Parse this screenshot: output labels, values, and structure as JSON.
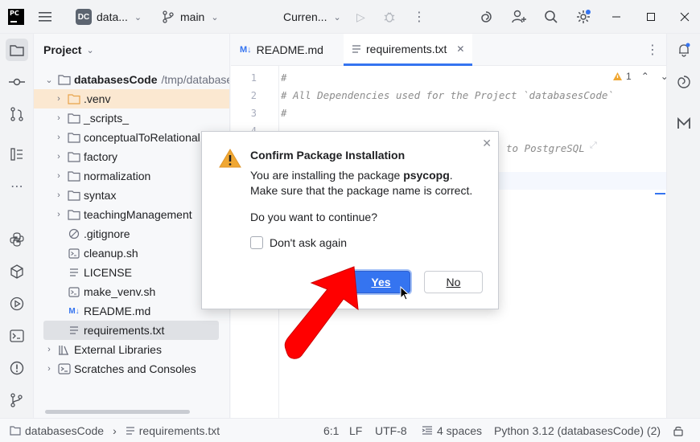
{
  "titlebar": {
    "logo": "PC",
    "project_badge": "DC",
    "project_name": "data...",
    "branch": "main",
    "run_config": "Curren..."
  },
  "project_panel": {
    "title": "Project",
    "root": {
      "name": "databasesCode",
      "path": "/tmp/database"
    },
    "items": [
      {
        "label": ".venv",
        "type": "folder",
        "expandable": true
      },
      {
        "label": "_scripts_",
        "type": "folder",
        "expandable": true
      },
      {
        "label": "conceptualToRelational",
        "type": "folder",
        "expandable": true
      },
      {
        "label": "factory",
        "type": "folder",
        "expandable": true
      },
      {
        "label": "normalization",
        "type": "folder",
        "expandable": true
      },
      {
        "label": "syntax",
        "type": "folder",
        "expandable": true
      },
      {
        "label": "teachingManagement",
        "type": "folder",
        "expandable": true
      },
      {
        "label": ".gitignore",
        "type": "ignore-file"
      },
      {
        "label": "cleanup.sh",
        "type": "shell-file"
      },
      {
        "label": "LICENSE",
        "type": "text-file"
      },
      {
        "label": "make_venv.sh",
        "type": "shell-file"
      },
      {
        "label": "README.md",
        "type": "markdown-file"
      },
      {
        "label": "requirements.txt",
        "type": "text-file"
      }
    ],
    "external_libraries": "External Libraries",
    "scratches": "Scratches and Consoles"
  },
  "editor": {
    "tabs": [
      {
        "label": "README.md",
        "icon": "M↓"
      },
      {
        "label": "requirements.txt",
        "icon": "lines-icon",
        "active": true
      }
    ],
    "warning_count": "1",
    "line_numbers": [
      "1",
      "2",
      "3",
      "4"
    ],
    "lines": [
      "#",
      "# All Dependencies used for the Project `databasesCode`",
      "#",
      ""
    ],
    "partial_line": "to PostgreSQL"
  },
  "dialog": {
    "title": "Confirm Package Installation",
    "message_prefix": "You are installing the package ",
    "package": "psycopg",
    "message_suffix": ".",
    "line2": "Make sure that the package name is correct.",
    "question": "Do you want to continue?",
    "checkbox_label": "Don't ask again",
    "yes_label": "Yes",
    "no_label": "No"
  },
  "statusbar": {
    "breadcrumb_root": "databasesCode",
    "breadcrumb_file": "requirements.txt",
    "position": "6:1",
    "line_sep": "LF",
    "encoding": "UTF-8",
    "indent": "4 spaces",
    "interpreter": "Python 3.12 (databasesCode) (2)"
  },
  "colors": {
    "accent": "#3574f0",
    "warning": "#f0a732",
    "arrow": "#ff0000"
  }
}
